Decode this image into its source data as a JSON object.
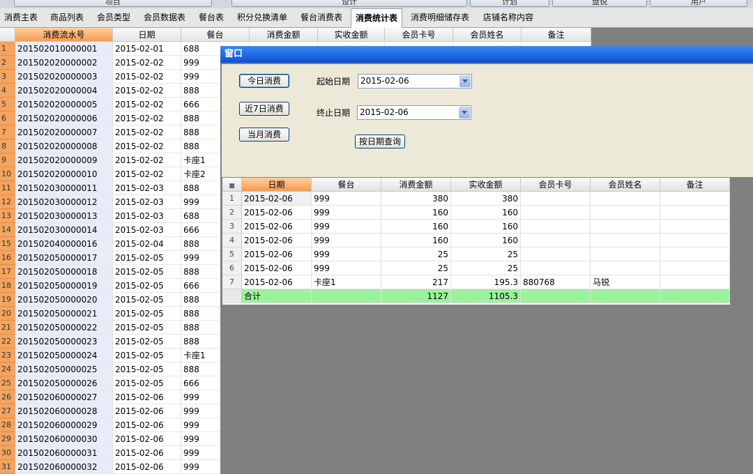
{
  "ribbon": {
    "items": [
      "项目",
      "设计",
      "计划",
      "盘锐",
      "用户"
    ]
  },
  "tabs": [
    "消费主表",
    "商品列表",
    "会员类型",
    "会员数据表",
    "餐台表",
    "积分兑换清单",
    "餐台消费表",
    "消费统计表",
    "消费明细储存表",
    "店铺名称内容"
  ],
  "active_tab": "消费统计表",
  "main_grid": {
    "columns": [
      "消费流水号",
      "日期",
      "餐台",
      "消费金额",
      "实收金额",
      "会员卡号",
      "会员姓名",
      "备注"
    ],
    "rows": [
      [
        "201502010000001",
        "2015-02-01",
        "688"
      ],
      [
        "201502020000002",
        "2015-02-02",
        "999"
      ],
      [
        "201502020000003",
        "2015-02-02",
        "999"
      ],
      [
        "201502020000004",
        "2015-02-02",
        "888"
      ],
      [
        "201502020000005",
        "2015-02-02",
        "666"
      ],
      [
        "201502020000006",
        "2015-02-02",
        "888"
      ],
      [
        "201502020000007",
        "2015-02-02",
        "888"
      ],
      [
        "201502020000008",
        "2015-02-02",
        "888"
      ],
      [
        "201502020000009",
        "2015-02-02",
        "卡座1"
      ],
      [
        "201502020000010",
        "2015-02-02",
        "卡座2"
      ],
      [
        "201502030000011",
        "2015-02-03",
        "888"
      ],
      [
        "201502030000012",
        "2015-02-03",
        "999"
      ],
      [
        "201502030000013",
        "2015-02-03",
        "688"
      ],
      [
        "201502030000014",
        "2015-02-03",
        "666"
      ],
      [
        "201502040000016",
        "2015-02-04",
        "888"
      ],
      [
        "201502050000017",
        "2015-02-05",
        "999"
      ],
      [
        "201502050000018",
        "2015-02-05",
        "888"
      ],
      [
        "201502050000019",
        "2015-02-05",
        "666"
      ],
      [
        "201502050000020",
        "2015-02-05",
        "888"
      ],
      [
        "201502050000021",
        "2015-02-05",
        "888"
      ],
      [
        "201502050000022",
        "2015-02-05",
        "888"
      ],
      [
        "201502050000023",
        "2015-02-05",
        "888"
      ],
      [
        "201502050000024",
        "2015-02-05",
        "卡座1"
      ],
      [
        "201502050000025",
        "2015-02-05",
        "888"
      ],
      [
        "201502050000026",
        "2015-02-05",
        "666"
      ],
      [
        "201502060000027",
        "2015-02-06",
        "999"
      ],
      [
        "201502060000028",
        "2015-02-06",
        "999"
      ],
      [
        "201502060000029",
        "2015-02-06",
        "999"
      ],
      [
        "201502060000030",
        "2015-02-06",
        "999"
      ],
      [
        "201502060000031",
        "2015-02-06",
        "999"
      ],
      [
        "201502060000032",
        "2015-02-06",
        "999"
      ]
    ]
  },
  "window": {
    "title": "窗口",
    "btn_today": "今日消费",
    "btn_7days": "近7日消费",
    "btn_month": "当月消费",
    "start_label": "起始日期",
    "start_value": "2015-02-06",
    "end_label": "终止日期",
    "end_value": "2015-02-06",
    "btn_query": "按日期查询",
    "grid": {
      "columns": [
        "日期",
        "餐台",
        "消费金额",
        "实收金额",
        "会员卡号",
        "会员姓名",
        "备注"
      ],
      "rows": [
        [
          "2015-02-06",
          "999",
          "380",
          "380",
          "",
          "",
          ""
        ],
        [
          "2015-02-06",
          "999",
          "160",
          "160",
          "",
          "",
          ""
        ],
        [
          "2015-02-06",
          "999",
          "160",
          "160",
          "",
          "",
          ""
        ],
        [
          "2015-02-06",
          "999",
          "160",
          "160",
          "",
          "",
          ""
        ],
        [
          "2015-02-06",
          "999",
          "25",
          "25",
          "",
          "",
          ""
        ],
        [
          "2015-02-06",
          "999",
          "25",
          "25",
          "",
          "",
          ""
        ],
        [
          "2015-02-06",
          "卡座1",
          "217",
          "195.3",
          "880768",
          "马锐",
          ""
        ]
      ],
      "total": [
        "合计",
        "",
        "1127",
        "1105.3",
        "",
        "",
        ""
      ]
    }
  },
  "colors": {
    "accent_orange": "#f59a52",
    "sum_green": "#9cf29c",
    "title_blue": "#0a4fd8"
  }
}
